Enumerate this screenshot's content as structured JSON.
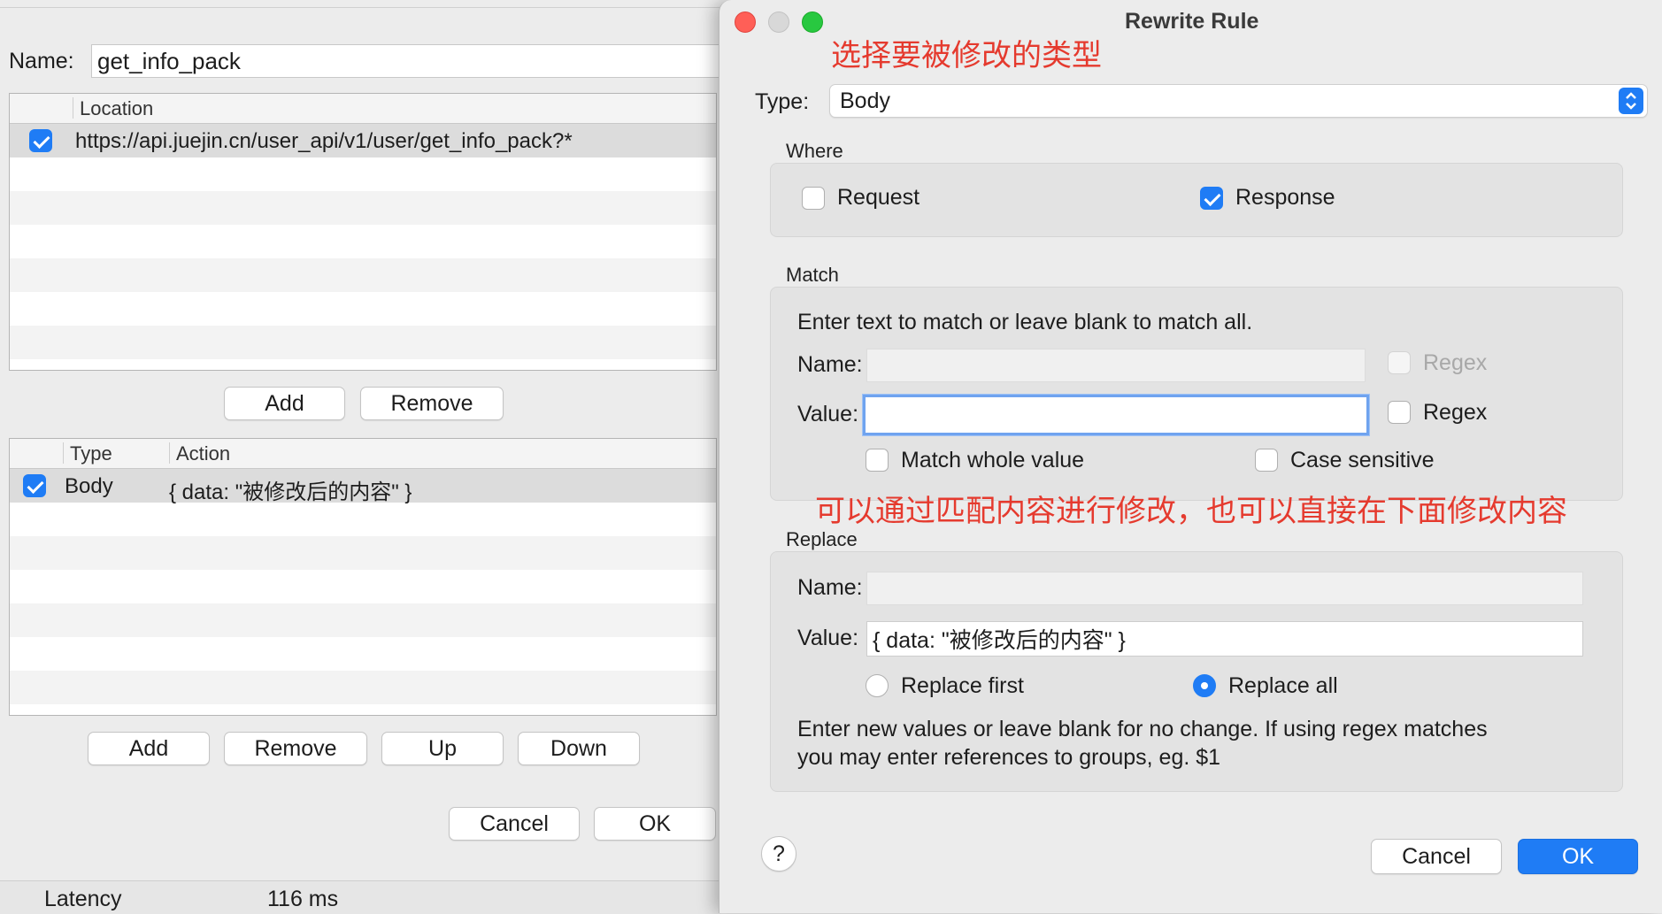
{
  "left": {
    "name_label": "Name:",
    "name_value": "get_info_pack",
    "location_table": {
      "header": "Location",
      "rows": [
        {
          "checked": true,
          "location": "https://api.juejin.cn/user_api/v1/user/get_info_pack?*"
        }
      ]
    },
    "location_buttons": {
      "add": "Add",
      "remove": "Remove"
    },
    "rules_table": {
      "headers": [
        "Type",
        "Action"
      ],
      "rows": [
        {
          "checked": true,
          "type": "Body",
          "action": "{ data: \"被修改后的内容\" }"
        }
      ]
    },
    "rule_buttons": {
      "add": "Add",
      "remove": "Remove",
      "up": "Up",
      "down": "Down"
    },
    "footer_buttons": {
      "cancel": "Cancel",
      "ok": "OK"
    },
    "status": {
      "label": "Latency",
      "value": "116 ms"
    }
  },
  "dialog": {
    "title": "Rewrite Rule",
    "type_label": "Type:",
    "type_value": "Body",
    "where": {
      "label": "Where",
      "request": {
        "label": "Request",
        "checked": false
      },
      "response": {
        "label": "Response",
        "checked": true
      }
    },
    "match": {
      "label": "Match",
      "hint": "Enter text to match or leave blank to match all.",
      "name_label": "Name:",
      "name_value": "",
      "name_regex": "Regex",
      "value_label": "Value:",
      "value_value": "",
      "value_regex": "Regex",
      "match_whole": "Match whole value",
      "case_sensitive": "Case sensitive"
    },
    "replace": {
      "label": "Replace",
      "name_label": "Name:",
      "name_value": "",
      "value_label": "Value:",
      "value_value": "{ data: \"被修改后的内容\" }",
      "replace_first": "Replace first",
      "replace_all": "Replace all",
      "selected": "replace_all",
      "hint_line1": "Enter new values or leave blank for no change. If using regex matches",
      "hint_line2": "you may enter references to groups, eg. $1"
    },
    "help": "?",
    "cancel": "Cancel",
    "ok": "OK"
  },
  "annotations": {
    "type_note": "选择要被修改的类型",
    "match_note": "可以通过匹配内容进行修改，也可以直接在下面修改内容"
  },
  "colors": {
    "accent": "#1f7cf5",
    "annotation": "#e53a2e",
    "close": "#ff5f57",
    "zoom": "#28c840"
  }
}
